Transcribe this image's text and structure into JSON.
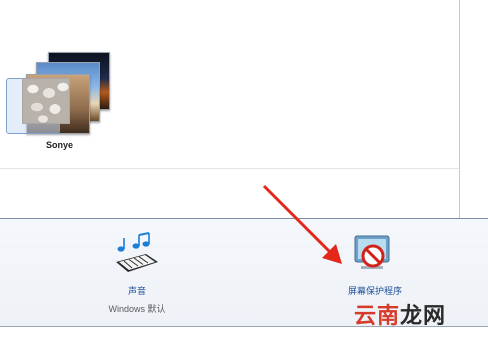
{
  "theme": {
    "name": "Sonye"
  },
  "sound": {
    "label": "声音",
    "sublabel": "Windows 默认",
    "icon": "music-notes-keyboard-icon"
  },
  "screensaver": {
    "label": "屏幕保护程序",
    "icon": "no-screensaver-icon"
  },
  "annotation": {
    "arrow_color": "#e3271b"
  },
  "watermark": {
    "part1": "云南",
    "part2": "龙网"
  }
}
